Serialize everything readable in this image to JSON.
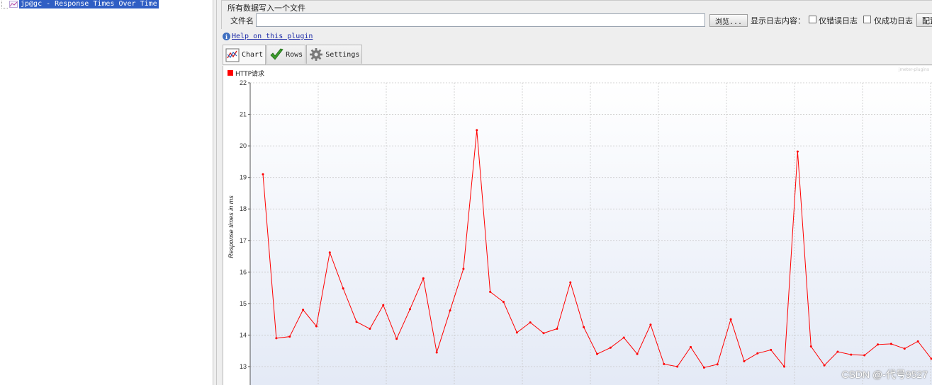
{
  "tree": {
    "selected_item": "jp@gc - Response Times Over Time"
  },
  "file_section": {
    "title": "所有数据写入一个文件",
    "filename_label": "文件名",
    "filename_value": "",
    "browse_label": "浏览...",
    "log_content_label": "显示日志内容：",
    "errors_only_label": "仅错误日志",
    "errors_only_checked": false,
    "success_only_label": "仅成功日志",
    "success_only_checked": false,
    "config_label": "配置"
  },
  "help": {
    "link_text": "Help on this plugin",
    "icon": "info-icon"
  },
  "tabs": [
    {
      "label": "Chart",
      "icon": "chart-icon",
      "active": true
    },
    {
      "label": "Rows",
      "icon": "checkmark-icon",
      "active": false
    },
    {
      "label": "Settings",
      "icon": "gear-icon",
      "active": false
    }
  ],
  "watermark": "CSDN @-代号9527",
  "plugin_mark": "jmeter-plugins",
  "colors": {
    "series": "#ff0000",
    "selection": "#2f5ec4",
    "grid": "#c8c8c8"
  },
  "chart_data": {
    "type": "line",
    "title": "",
    "ylabel": "Response times in ms",
    "xlabel": "",
    "ylim": [
      12.4,
      22
    ],
    "yticks": [
      13,
      14,
      15,
      16,
      17,
      18,
      19,
      20,
      21,
      22
    ],
    "grid": true,
    "legend_position": "top-left",
    "series": [
      {
        "name": "HTTP请求",
        "color": "#ff0000",
        "values": [
          19.1,
          13.9,
          13.95,
          14.8,
          14.28,
          16.62,
          15.48,
          14.42,
          14.2,
          14.95,
          13.88,
          14.82,
          15.8,
          13.45,
          14.78,
          16.1,
          20.5,
          15.37,
          15.05,
          14.08,
          14.4,
          14.06,
          14.2,
          15.67,
          14.25,
          13.4,
          13.6,
          13.92,
          13.4,
          14.33,
          13.08,
          13.0,
          13.62,
          12.97,
          13.07,
          14.5,
          13.17,
          13.42,
          13.53,
          13.0,
          19.82,
          13.64,
          13.04,
          13.47,
          13.38,
          13.36,
          13.7,
          13.72,
          13.57,
          13.8,
          13.25
        ]
      }
    ]
  }
}
